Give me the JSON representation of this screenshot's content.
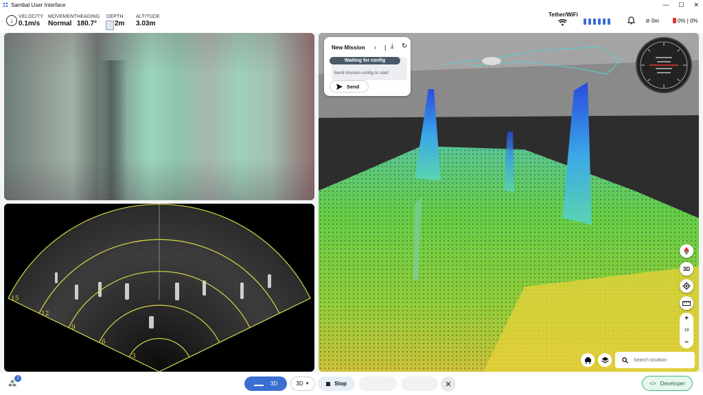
{
  "window": {
    "title": "Sambal User Interface",
    "minimize": "—",
    "maximize": "☐",
    "close": "✕"
  },
  "telemetry": {
    "velocity": {
      "label": "VELOCITY",
      "value": "0.1m/s"
    },
    "movement": {
      "label": "MOVEMENT",
      "value": "Normal"
    },
    "heading": {
      "label": "HEADING",
      "value": "180.7°"
    },
    "depth": {
      "label": "DEPTH",
      "value": "2m"
    },
    "altitude": {
      "label": "ALTITUDE",
      "value": "3.03m"
    }
  },
  "connection": {
    "label": "Tether/WiFi",
    "signal_bars": 6
  },
  "status": {
    "nofly_value": "0m",
    "battery_value": "0% | 0%"
  },
  "mission": {
    "title": "New Mission",
    "status_pill": "Waiting for config",
    "status_desc": "Send mission config to start",
    "send_label": "Send"
  },
  "sonar": {
    "range_labels": [
      "3",
      "6",
      "9",
      "12",
      "15"
    ]
  },
  "map": {
    "btn_3d": "3D",
    "zoom_in": "+",
    "zoom_level": "19",
    "zoom_out": "−",
    "search_placeholder": "Search location"
  },
  "bottom": {
    "agent_badge": "1",
    "view_3d_label": "3D",
    "view_select_label": "3D",
    "stop_label": "Stop",
    "developer_label": "Developer"
  },
  "colors": {
    "accent": "#3b6fd1",
    "sonar_arc": "#d8d84a",
    "developer": "#3fb37f"
  }
}
